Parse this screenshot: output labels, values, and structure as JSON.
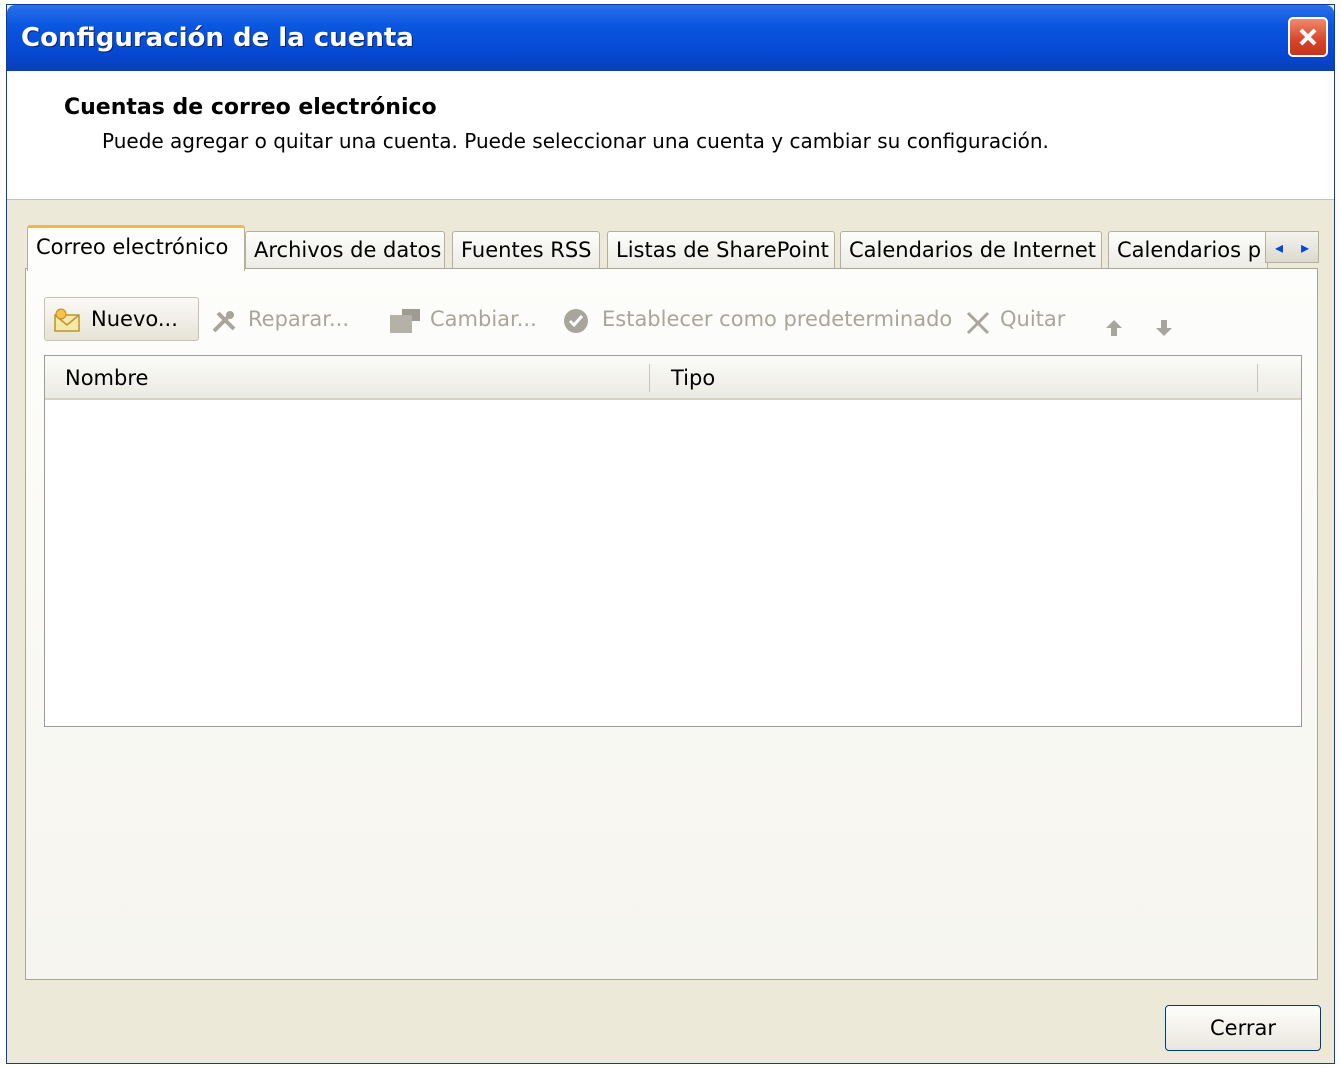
{
  "window": {
    "title": "Configuración de la cuenta"
  },
  "header": {
    "title": "Cuentas de correo electrónico",
    "subtitle": "Puede agregar o quitar una cuenta. Puede seleccionar una cuenta y cambiar su configuración."
  },
  "tabs": [
    {
      "label": "Correo electrónico",
      "active": true
    },
    {
      "label": "Archivos de datos",
      "active": false
    },
    {
      "label": "Fuentes RSS",
      "active": false
    },
    {
      "label": "Listas de SharePoint",
      "active": false
    },
    {
      "label": "Calendarios de Internet",
      "active": false
    },
    {
      "label": "Calendarios p",
      "active": false
    }
  ],
  "toolbar": {
    "new_label": "Nuevo...",
    "repair_label": "Reparar...",
    "change_label": "Cambiar...",
    "default_label": "Establecer como predeterminado",
    "remove_label": "Quitar"
  },
  "table": {
    "columns": [
      "Nombre",
      "Tipo"
    ],
    "rows": []
  },
  "footer": {
    "close_label": "Cerrar"
  },
  "colors": {
    "titlebar": "#0649d4",
    "window_bg": "#ece9d8",
    "active_tab_accent": "#f3b64b",
    "disabled_text": "#a8a69c"
  }
}
